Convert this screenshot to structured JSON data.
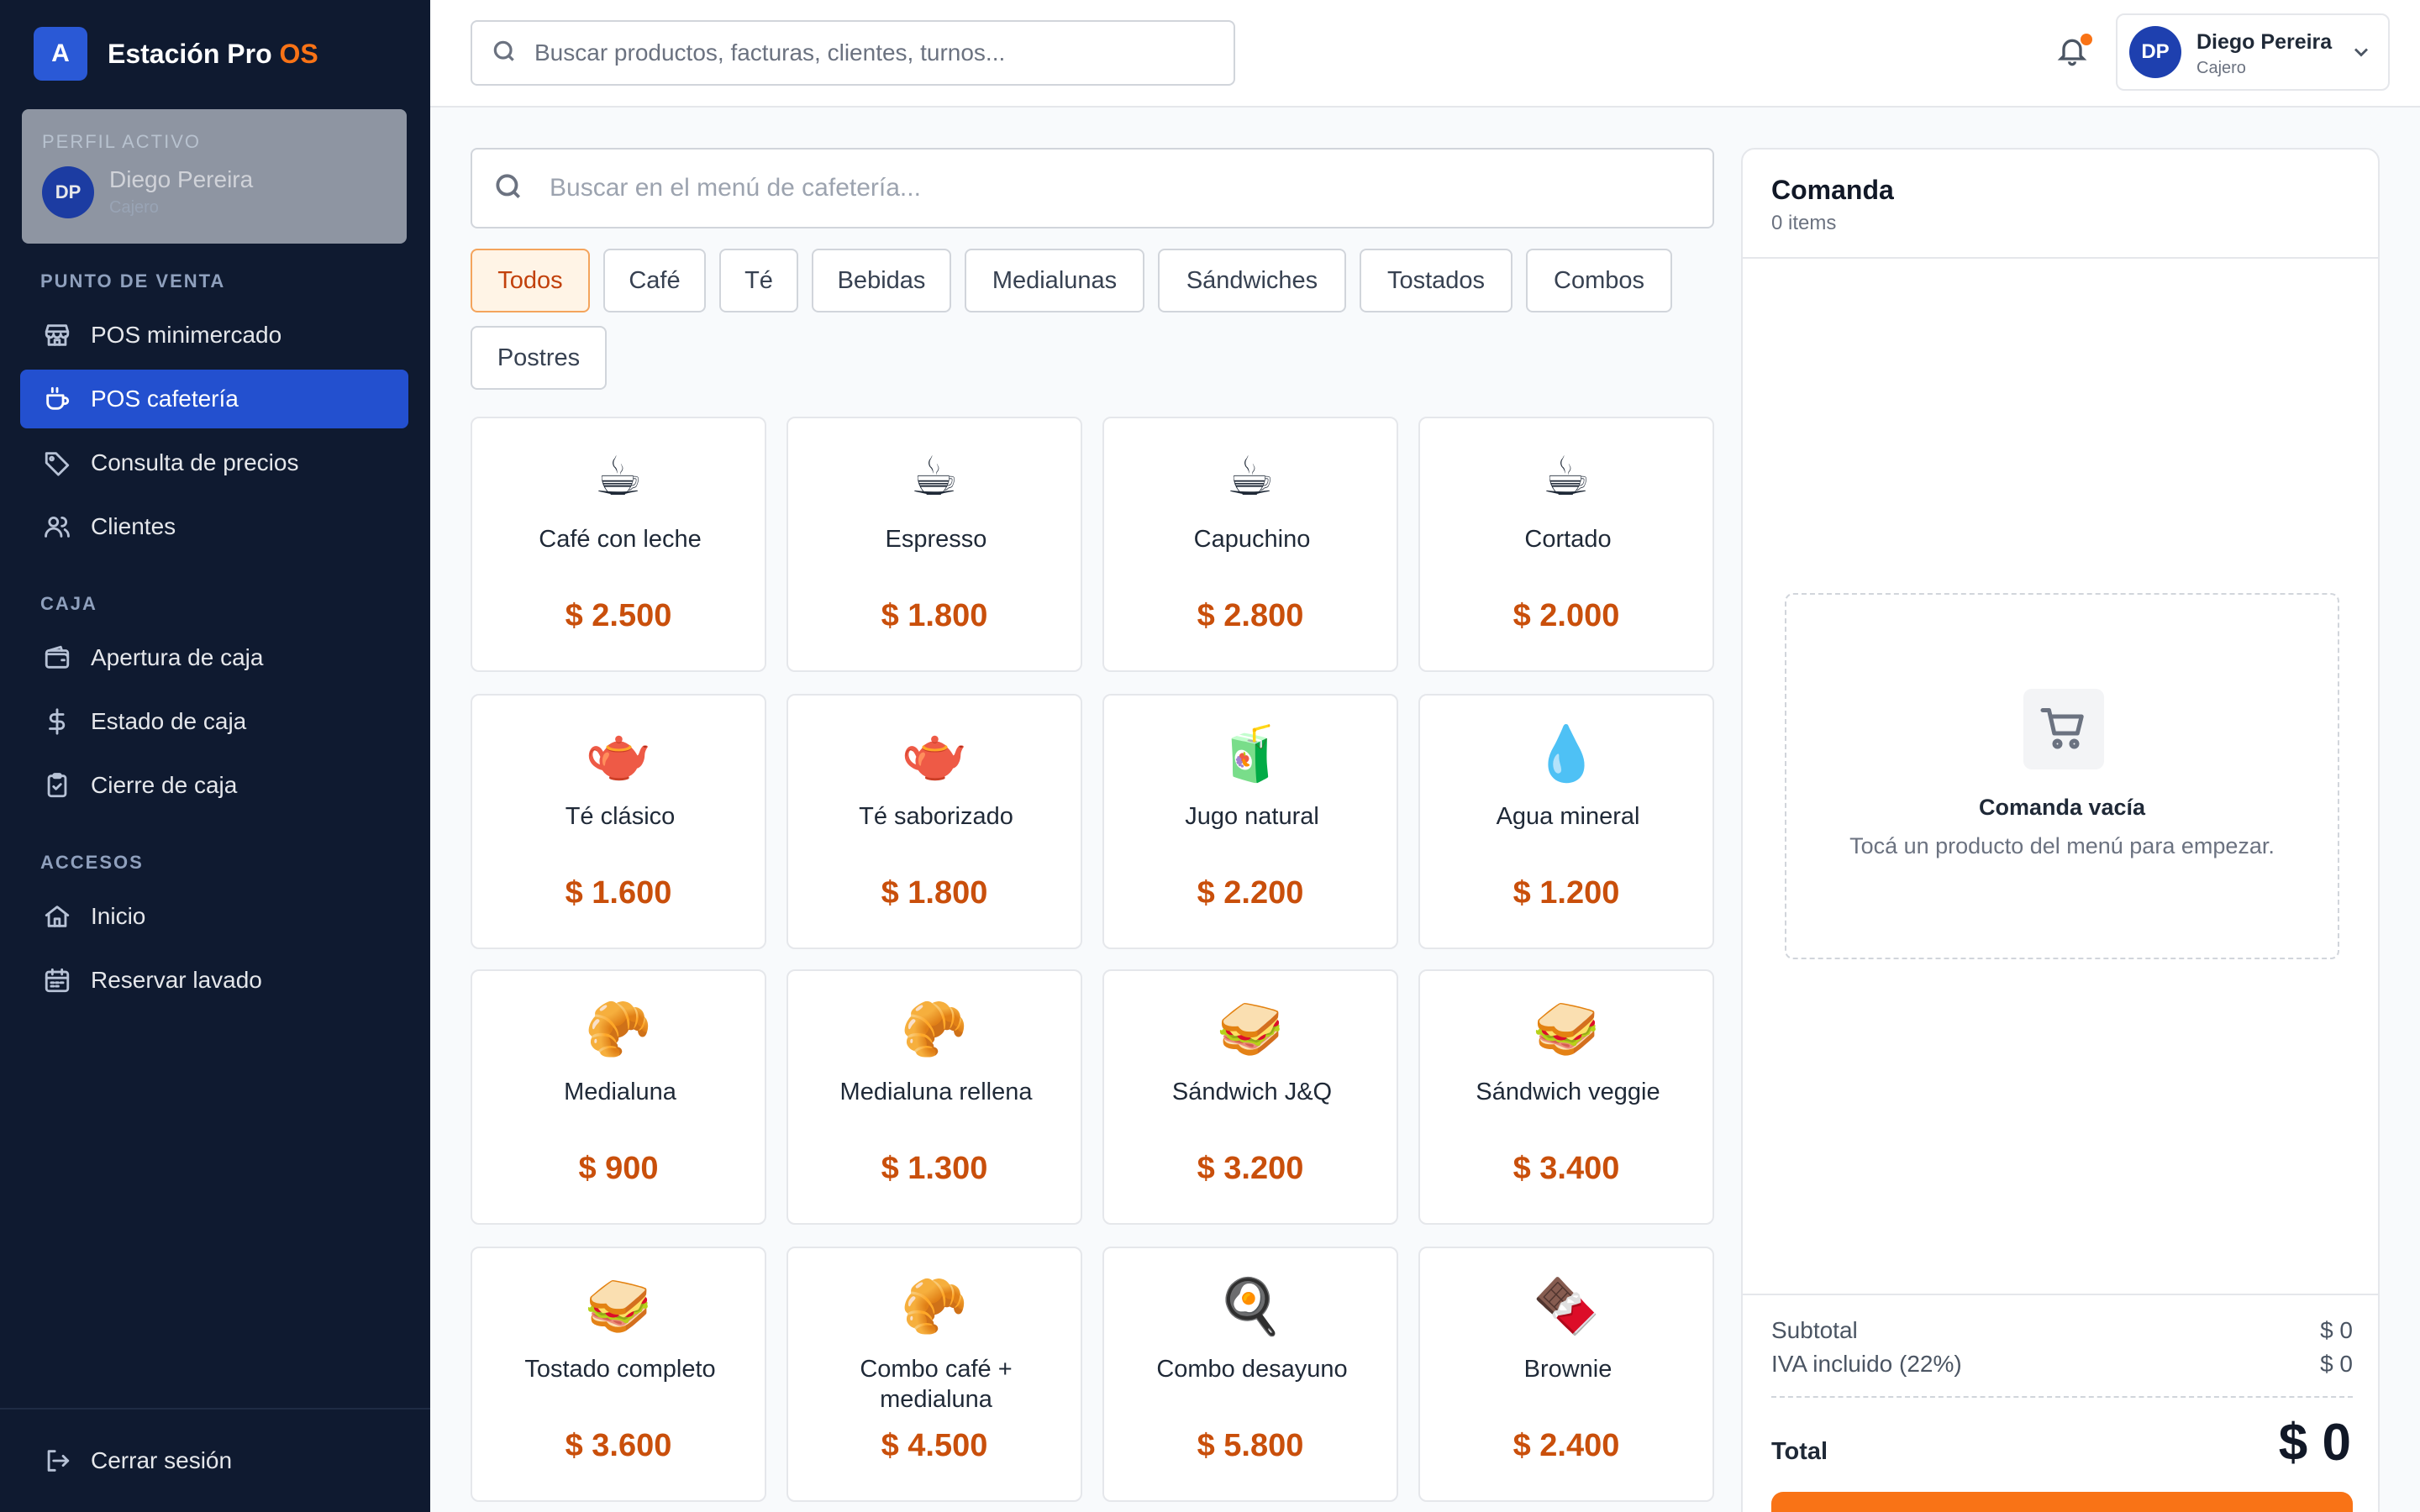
{
  "brand": {
    "logo_letter": "A",
    "name": "Estación Pro",
    "accent": "OS"
  },
  "profile": {
    "label": "PERFIL ACTIVO",
    "initials": "DP",
    "name": "Diego Pereira",
    "role": "Cajero"
  },
  "sidebar": {
    "section_pos": "PUNTO DE VENTA",
    "section_caja": "CAJA",
    "section_accesos": "ACCESOS",
    "items": [
      {
        "label": "POS minimercado",
        "icon": "store-icon"
      },
      {
        "label": "POS cafetería",
        "icon": "coffee-cup-icon",
        "active": true
      },
      {
        "label": "Consulta de precios",
        "icon": "tag-icon"
      },
      {
        "label": "Clientes",
        "icon": "users-icon"
      },
      {
        "label": "Apertura de caja",
        "icon": "wallet-icon"
      },
      {
        "label": "Estado de caja",
        "icon": "dollar-icon"
      },
      {
        "label": "Cierre de caja",
        "icon": "clipboard-check-icon"
      },
      {
        "label": "Inicio",
        "icon": "home-icon"
      },
      {
        "label": "Reservar lavado",
        "icon": "calendar-icon"
      }
    ],
    "logout": "Cerrar sesión"
  },
  "topbar": {
    "search_placeholder": "Buscar productos, facturas, clientes, turnos...",
    "user_initials": "DP",
    "user_name": "Diego Pereira",
    "user_role": "Cajero"
  },
  "menu": {
    "search_placeholder": "Buscar en el menú de cafetería...",
    "categories": [
      "Todos",
      "Café",
      "Té",
      "Bebidas",
      "Medialunas",
      "Sándwiches",
      "Tostados",
      "Combos",
      "Postres"
    ],
    "active_category": "Todos",
    "products": [
      {
        "emoji": "☕",
        "name": "Café con leche",
        "price": "$ 2.500"
      },
      {
        "emoji": "☕",
        "name": "Espresso",
        "price": "$ 1.800"
      },
      {
        "emoji": "☕",
        "name": "Capuchino",
        "price": "$ 2.800"
      },
      {
        "emoji": "☕",
        "name": "Cortado",
        "price": "$ 2.000"
      },
      {
        "emoji": "🫖",
        "name": "Té clásico",
        "price": "$ 1.600"
      },
      {
        "emoji": "🫖",
        "name": "Té saborizado",
        "price": "$ 1.800"
      },
      {
        "emoji": "🧃",
        "name": "Jugo natural",
        "price": "$ 2.200"
      },
      {
        "emoji": "💧",
        "name": "Agua mineral",
        "price": "$ 1.200"
      },
      {
        "emoji": "🥐",
        "name": "Medialuna",
        "price": "$ 900"
      },
      {
        "emoji": "🥐",
        "name": "Medialuna rellena",
        "price": "$ 1.300"
      },
      {
        "emoji": "🥪",
        "name": "Sándwich J&Q",
        "price": "$ 3.200"
      },
      {
        "emoji": "🥪",
        "name": "Sándwich veggie",
        "price": "$ 3.400"
      },
      {
        "emoji": "🥪",
        "name": "Tostado completo",
        "price": "$ 3.600"
      },
      {
        "emoji": "🥐",
        "name": "Combo café + medialuna",
        "price": "$ 4.500"
      },
      {
        "emoji": "🍳",
        "name": "Combo desayuno",
        "price": "$ 5.800"
      },
      {
        "emoji": "🍫",
        "name": "Brownie",
        "price": "$ 2.400"
      }
    ]
  },
  "order": {
    "title": "Comanda",
    "count": "0 items",
    "empty_title": "Comanda vacía",
    "empty_sub": "Tocá un producto del menú para empezar.",
    "subtotal_label": "Subtotal",
    "subtotal_value": "$ 0",
    "iva_label": "IVA incluido (22%)",
    "iva_value": "$ 0",
    "total_label": "Total",
    "total_value": "$ 0"
  },
  "colors": {
    "accent": "#f97316",
    "primary": "#2350cf",
    "sidebar": "#0f1a30",
    "price": "#c94f0b"
  }
}
